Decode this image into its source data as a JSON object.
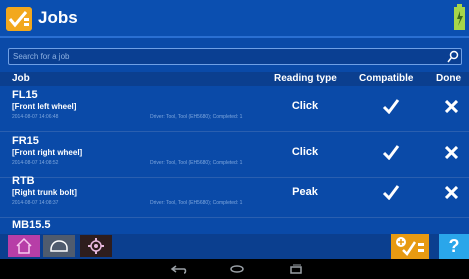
{
  "header": {
    "title": "Jobs",
    "logo_icon": "job-check-logo-icon",
    "battery_icon": "battery-icon"
  },
  "search": {
    "placeholder": "Search for a job",
    "icon": "search-icon"
  },
  "table": {
    "columns": {
      "job": "Job",
      "reading_type": "Reading type",
      "compatible": "Compatible",
      "done": "Done"
    },
    "rows": [
      {
        "code": "FL15",
        "description": "[Front left wheel]",
        "date": "2014-08-07 14:06:48",
        "meta": "Driver: Tool, Tool (EH5680); Completed: 1",
        "reading_type": "Click"
      },
      {
        "code": "FR15",
        "description": "[Front right wheel]",
        "date": "2014-08-07 14:08:52",
        "meta": "Driver: Tool, Tool (EH5680); Completed: 1",
        "reading_type": "Click"
      },
      {
        "code": "RTB",
        "description": "[Right trunk bolt]",
        "date": "2014-08-07 14:08:37",
        "meta": "Driver: Tool, Tool (EH5680); Completed: 1",
        "reading_type": "Peak"
      }
    ],
    "partial_row": {
      "code": "MB15.5"
    }
  },
  "bottom_bar": {
    "help_label": "?",
    "icons": [
      "home-icon",
      "car-icon",
      "gear-icon",
      "new-job-icon",
      "help-icon"
    ]
  },
  "system_nav": {
    "icons": [
      "back-icon",
      "home-nav-icon",
      "recent-apps-icon"
    ]
  },
  "colors": {
    "primary_blue": "#0a4aa8",
    "accent_orange": "#e79a12",
    "help_blue": "#2aa6ea",
    "home_pink": "#b73ea7"
  }
}
